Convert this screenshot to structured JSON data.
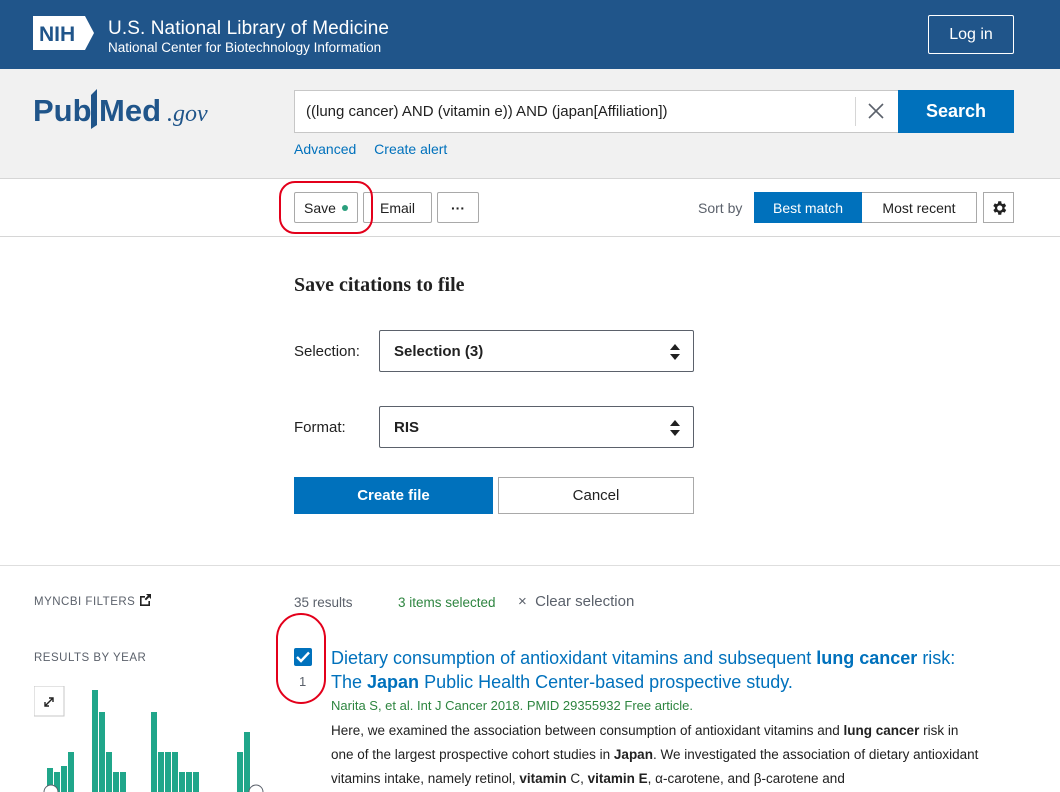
{
  "header": {
    "nih_badge": "NIH",
    "title": "U.S. National Library of Medicine",
    "subtitle": "National Center for Biotechnology Information",
    "login_label": "Log in"
  },
  "search": {
    "logo_text": "PubMed",
    "logo_suffix": ".gov",
    "query": "((lung cancer) AND (vitamin e)) AND (japan[Affiliation])",
    "search_label": "Search",
    "advanced_label": "Advanced",
    "create_alert_label": "Create alert"
  },
  "toolbar": {
    "save_label": "Save",
    "email_label": "Email",
    "more_label": "···",
    "sort_by_label": "Sort by",
    "sort_best_label": "Best match",
    "sort_recent_label": "Most recent"
  },
  "save_panel": {
    "title": "Save citations to file",
    "selection_label": "Selection:",
    "selection_value": "Selection (3)",
    "format_label": "Format:",
    "format_value": "RIS",
    "create_label": "Create file",
    "cancel_label": "Cancel"
  },
  "sidebar": {
    "myncbi_label": "MYNCBI FILTERS",
    "results_by_year_label": "RESULTS BY YEAR"
  },
  "results": {
    "count_label": "35 results",
    "selected_label": "3 items selected",
    "clear_label": "Clear selection",
    "items": [
      {
        "number": "1",
        "title_parts": [
          "Dietary consumption of antioxidant vitamins and subsequent ",
          "lung cancer",
          " risk:",
          "The ",
          "Japan",
          " Public Health Center-based prospective study."
        ],
        "citation": "Narita S, et al. Int J Cancer 2018. PMID 29355932 Free article.",
        "snippet_parts": [
          "Here, we examined the association between consumption of antioxidant vitamins and ",
          "lung cancer",
          " risk in one of the largest prospective cohort studies in ",
          "Japan",
          ". We investigated the association of dietary antioxidant vitamins intake, namely retinol, ",
          "vitamin",
          " C, ",
          "vitamin E",
          ", α-carotene, and β-carotene and"
        ]
      }
    ]
  },
  "colors": {
    "nih_blue": "#20558a",
    "link_blue": "#0071bc",
    "green": "#2e8540",
    "annotation_red": "#e3001b",
    "chart_teal": "#20a68a"
  }
}
